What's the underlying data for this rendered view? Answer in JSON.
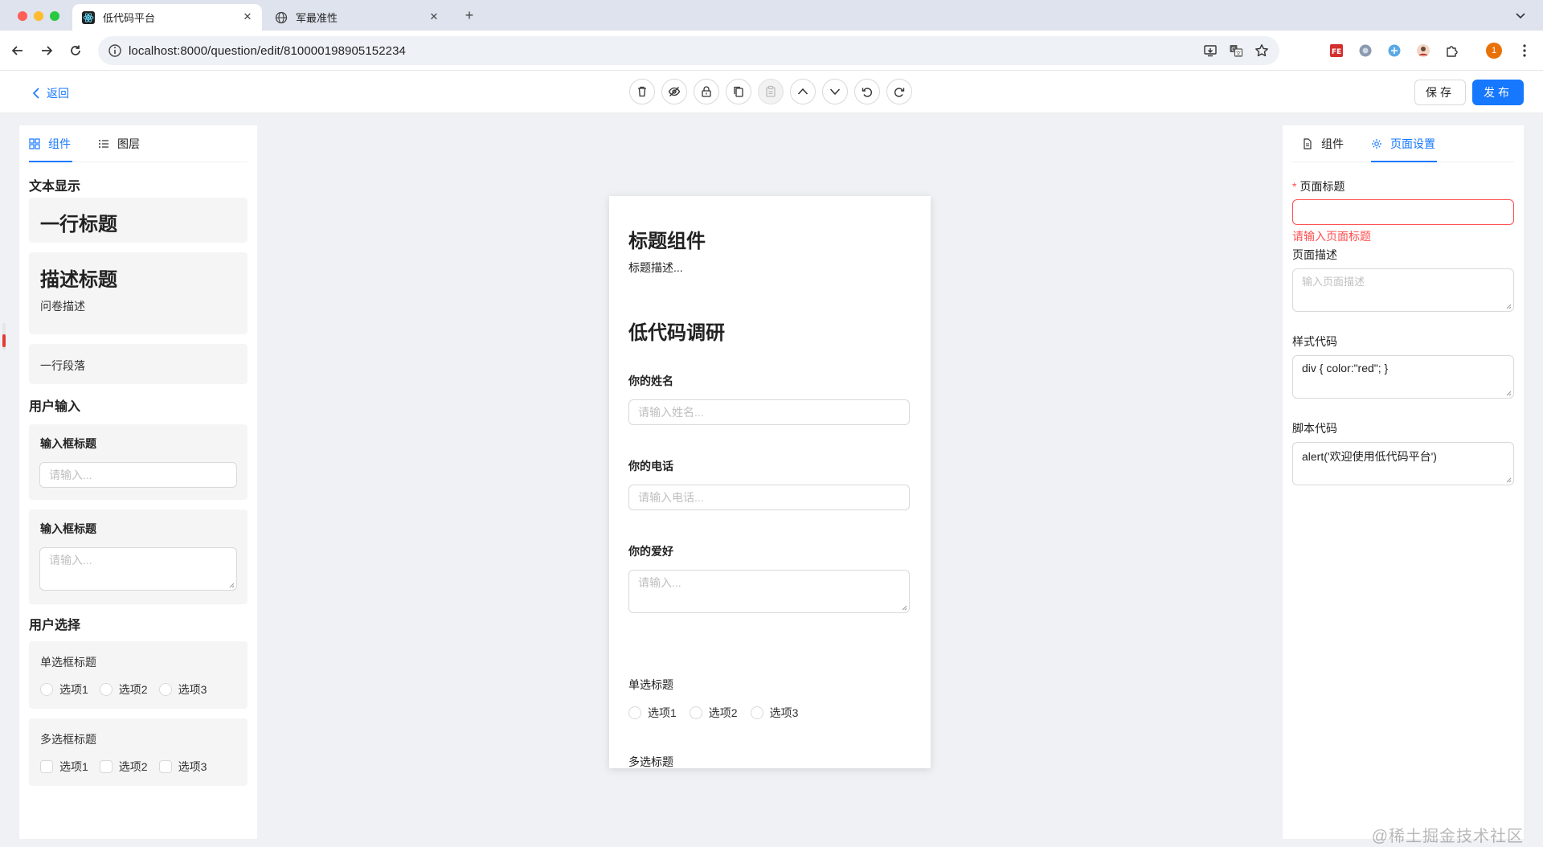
{
  "browser": {
    "tabs": [
      {
        "title": "低代码平台",
        "active": true
      },
      {
        "title": "军最准性",
        "active": false
      }
    ],
    "url": "localhost:8000/question/edit/810000198905152234",
    "profile_initial": "1"
  },
  "header": {
    "back_label": "返回",
    "save_label": "保存",
    "publish_label": "发布",
    "tool_icons": [
      "trash-icon",
      "eye-off-icon",
      "lock-icon",
      "copy-icon",
      "paste-icon",
      "arrow-up-icon",
      "arrow-down-icon",
      "undo-icon",
      "redo-icon"
    ],
    "accent_color": "#1677ff"
  },
  "left_panel": {
    "tabs": [
      {
        "label": "组件",
        "active": true
      },
      {
        "label": "图层",
        "active": false
      }
    ],
    "sections": {
      "text_display": "文本显示",
      "user_input": "用户输入",
      "user_choice": "用户选择"
    },
    "title_card": {
      "text": "一行标题"
    },
    "desc_card": {
      "title": "描述标题",
      "desc": "问卷描述"
    },
    "paragraph_card": {
      "text": "一行段落"
    },
    "input_card": {
      "label": "输入框标题",
      "placeholder": "请输入..."
    },
    "textarea_card": {
      "label": "输入框标题",
      "placeholder": "请输入..."
    },
    "radio_card": {
      "label": "单选框标题",
      "options": [
        "选项1",
        "选项2",
        "选项3"
      ]
    },
    "checkbox_card": {
      "label": "多选框标题",
      "options": [
        "选项1",
        "选项2",
        "选项3"
      ]
    }
  },
  "canvas": {
    "title": "标题组件",
    "title_desc": "标题描述...",
    "heading": "低代码调研",
    "name_label": "你的姓名",
    "name_placeholder": "请输入姓名...",
    "phone_label": "你的电话",
    "phone_placeholder": "请输入电话...",
    "hobby_label": "你的爱好",
    "hobby_placeholder": "请输入...",
    "radio_label": "单选标题",
    "radio_options": [
      "选项1",
      "选项2",
      "选项3"
    ],
    "checkbox_label": "多选标题"
  },
  "right_panel": {
    "tabs": [
      {
        "label": "组件",
        "active": false
      },
      {
        "label": "页面设置",
        "active": true
      }
    ],
    "page_title_label": "页面标题",
    "page_title_value": "",
    "page_title_error": "请输入页面标题",
    "page_desc_label": "页面描述",
    "page_desc_placeholder": "输入页面描述",
    "style_code_label": "样式代码",
    "style_code_value": "div { color:\"red\"; }",
    "script_code_label": "脚本代码",
    "script_code_value": "alert('欢迎使用低代码平台')",
    "error_color": "#ff4d4f"
  },
  "watermark": "@稀土掘金技术社区"
}
